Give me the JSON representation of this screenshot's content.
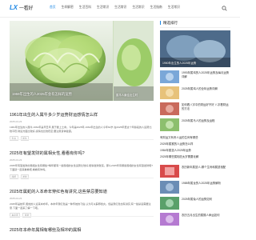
{
  "header": {
    "logo_a": "LX",
    "logo_b": "",
    "logo_c": "一看好",
    "nav": [
      {
        "label": "首页",
        "active": true
      },
      {
        "label": "生命解密",
        "active": false
      },
      {
        "label": "生活百科",
        "active": false
      },
      {
        "label": "生活常识",
        "active": false
      },
      {
        "label": "生活常识",
        "active": false
      },
      {
        "label": "生活常识",
        "active": false
      },
      {
        "label": "生活指南",
        "active": false
      },
      {
        "label": "生活常识",
        "active": false
      }
    ]
  },
  "hero": {
    "main_caption": "1959年出生的人2025年会有怎样的运势",
    "side_caption": "属羊人最佳出生时"
  },
  "articles": [
    {
      "title": "1961年出生的人属牛多少岁运势财运感情怎么样",
      "meta": [
        "2025-04-23",
        "阅读",
        "评论"
      ],
      "excerpt": "1961年出生的人属牛,1961年是辛丑年,属于壁上土命。今年是2025年,1961年出生的人今年64岁,在2025年里这个年龄段的人运势比较平稳,财运方面比较好,感情也比较稳定,要注意身体健康。",
      "tags": [
        "生肖",
        "属牛"
      ]
    },
    {
      "title": "2025年有望发财的属相女性,看看有你吗?",
      "meta": [
        "2025-04-23",
        "阅读",
        "评论"
      ],
      "excerpt": "2025年有望发财的属相女性有哪些?每年都有一些属相的女性运势比较好,能够发财致富。那么2025年有哪些属相的女性有望发财呢?下面就一起来看看吧,看看有你吗。",
      "tags": [
        "属相",
        "发财"
      ]
    },
    {
      "title": "2025年属蛇的人本命年穿红色有讲究,这些禁忌要知道",
      "meta": [
        "2025-04-23",
        "阅读",
        "评论"
      ],
      "excerpt": "2025年是蛇年,属蛇的人迎来本命年。本命年穿红色是一种传统的习俗,认为可以辟邪挡灾。但是穿红色也有讲究,有一些禁忌需要注意,下面一起来了解一下吧。",
      "tags": [
        "本命年",
        "属蛇"
      ]
    },
    {
      "title": "2025年本命年属相有哪些及相冲的属相",
      "meta": [],
      "excerpt": "",
      "tags": []
    }
  ],
  "sidebar": {
    "title": "精选排行",
    "featured_caption": "1950年出生的人2025年运势",
    "items": [
      {
        "text": "1993年属鸡的人2025年运势及每月运势详解",
        "date": "2025-04-23"
      },
      {
        "text": "2025年属鸡人的全年运势详解",
        "date": "2025-04-23"
      },
      {
        "text": "如何看八字中的财运好不好 八字看财运的方法",
        "date": "2025-04-23"
      },
      {
        "text": "2025年属马人的运势及运程",
        "date": "2025-04-23"
      }
    ],
    "sub_items": [
      "有财运又有贵人运的生肖有哪些",
      "2025年属猴的人运势怎么样",
      "1984年属鼠人2025年运势",
      "2025年哪些属相犯太岁需要化解"
    ],
    "bottom_items": [
      {
        "text": "农历新年属鼠人,哪个生肖和属鼠相配",
        "date": "2025-04-23"
      },
      {
        "text": "1988年属龙的人2025年运势解析",
        "date": "2025-04-23"
      },
      {
        "text": "2025年属兔人的运势如何",
        "date": "2025-04-23"
      },
      {
        "text": "农历五月出生的属猴人命运如何",
        "date": "2025-04-23"
      }
    ]
  },
  "colors": {
    "accent": "#1e88e5",
    "logo_red": "#e53935"
  }
}
